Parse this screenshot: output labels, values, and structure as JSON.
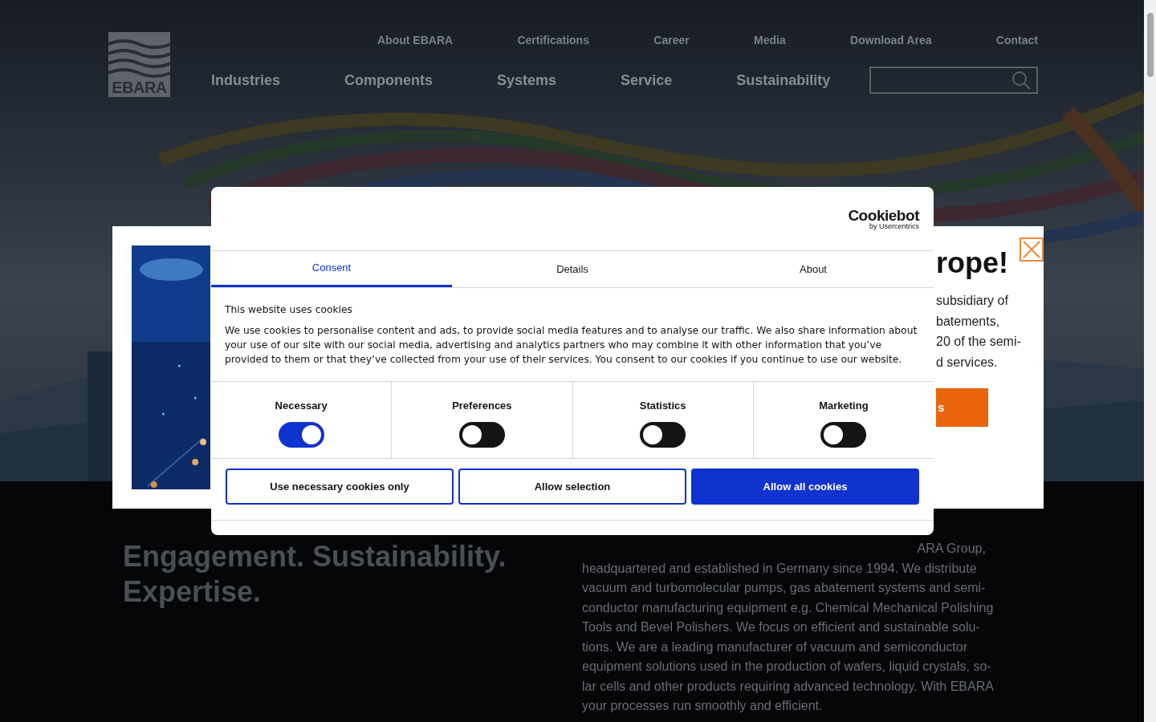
{
  "header": {
    "logo": "EBARA",
    "top_nav": [
      "About EBARA",
      "Certifications",
      "Career",
      "Media",
      "Download Area",
      "Contact"
    ],
    "main_nav": [
      "Industries",
      "Components",
      "Systems",
      "Service",
      "Sustainability"
    ]
  },
  "promo": {
    "heading": "rope!",
    "lines": [
      "subsidiary of",
      "batements,",
      "20 of the semi-",
      "d services."
    ],
    "button": "s"
  },
  "cookie_dialog": {
    "logo": "Cookiebot",
    "logo_sub": "by Usercentrics",
    "tabs": [
      {
        "label": "Consent",
        "selected": true
      },
      {
        "label": "Details",
        "selected": false
      },
      {
        "label": "About",
        "selected": false
      }
    ],
    "title": "This website uses cookies",
    "text": "We use cookies to personalise content and ads, to provide social media features and to analyse our traffic. We also share information about your use of our site with our social media, advertising and analytics partners who may combine it with other information that you’ve provided to them or that they’ve collected from your use of their services. You consent to our cookies if you continue to use our website.",
    "toggles": [
      {
        "label": "Necessary",
        "on": true
      },
      {
        "label": "Preferences",
        "on": false
      },
      {
        "label": "Statistics",
        "on": false
      },
      {
        "label": "Marketing",
        "on": false
      }
    ],
    "buttons": [
      {
        "label": "Use necessary cookies only",
        "kind": "outline"
      },
      {
        "label": "Allow selection",
        "kind": "outline"
      },
      {
        "label": "Allow all cookies",
        "kind": "primary"
      }
    ]
  },
  "intro": {
    "heading_lines": [
      "Engagement. Sustainability.",
      "Expertise."
    ],
    "lead": "ARA Group,",
    "paragraph_lines": [
      "headquartered and established in Germany since 1994. We distribute",
      "vacuum and turbomolecular pumps, gas abatement systems and semi-",
      "conductor manufacturing equipment e.g. Chemical Mechanical Polishing",
      "Tools and Bevel Polishers. We focus on efficient and sustainable solu-",
      "tions. We are a leading manufacturer of vacuum and semiconductor",
      "equipment solutions used in the production of wafers, liquid crystals, so-",
      "lar cells and other products requiring advanced technology. With EBARA",
      "your processes run smoothly and efficient."
    ]
  }
}
